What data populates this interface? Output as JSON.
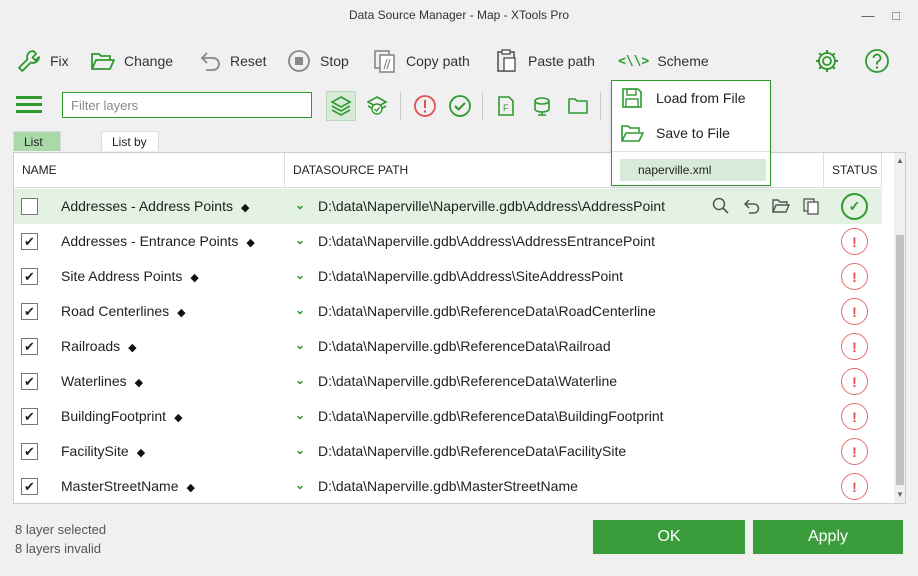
{
  "window": {
    "title": "Data Source Manager - Map  -  XTools Pro",
    "minimize_glyph": "—",
    "maximize_glyph": "□",
    "close_glyph": "✕"
  },
  "toolbar": {
    "fix": "Fix",
    "change": "Change",
    "reset": "Reset",
    "stop": "Stop",
    "copy_path": "Copy path",
    "paste_path": "Paste path",
    "scheme_glyph": "<\\\\>",
    "scheme": "Scheme",
    "settings_icon": "gear-icon",
    "help_icon": "help-icon"
  },
  "filter": {
    "placeholder": "Filter layers"
  },
  "tabs": {
    "by_layer": "List by layer",
    "by_source": "List by source"
  },
  "grid": {
    "headers": {
      "name": "NAME",
      "datasource": "DATASOURCE PATH",
      "status": "STATUS",
      "hidden_fragment": "S"
    },
    "rows": [
      {
        "name": "Addresses - Address Points",
        "checked": false,
        "selected": true,
        "path": "D:\\data\\Naperville\\Naperville.gdb\\Address\\AddressPoint",
        "status": "ok"
      },
      {
        "name": "Addresses - Entrance Points",
        "checked": true,
        "selected": false,
        "path": "D:\\data\\Naperville.gdb\\Address\\AddressEntrancePoint",
        "status": "error"
      },
      {
        "name": "Site Address Points",
        "checked": true,
        "selected": false,
        "path": "D:\\data\\Naperville.gdb\\Address\\SiteAddressPoint",
        "status": "error"
      },
      {
        "name": "Road Centerlines",
        "checked": true,
        "selected": false,
        "path": "D:\\data\\Naperville.gdb\\ReferenceData\\RoadCenterline",
        "status": "error"
      },
      {
        "name": "Railroads",
        "checked": true,
        "selected": false,
        "path": "D:\\data\\Naperville.gdb\\ReferenceData\\Railroad",
        "status": "error"
      },
      {
        "name": "Waterlines",
        "checked": true,
        "selected": false,
        "path": "D:\\data\\Naperville.gdb\\ReferenceData\\Waterline",
        "status": "error"
      },
      {
        "name": "BuildingFootprint",
        "checked": true,
        "selected": false,
        "path": "D:\\data\\Naperville.gdb\\ReferenceData\\BuildingFootprint",
        "status": "error"
      },
      {
        "name": "FacilitySite",
        "checked": true,
        "selected": false,
        "path": "D:\\data\\Naperville.gdb\\ReferenceData\\FacilitySite",
        "status": "error"
      },
      {
        "name": "MasterStreetName",
        "checked": true,
        "selected": false,
        "path": "D:\\data\\Naperville.gdb\\MasterStreetName",
        "status": "error"
      }
    ]
  },
  "dropdown": {
    "load": "Load from File",
    "save": "Save to File",
    "file": "naperville.xml"
  },
  "footer": {
    "selected": "8 layer selected",
    "invalid": "8 layers invalid",
    "ok": "OK",
    "apply": "Apply"
  },
  "colors": {
    "accent": "#2e9a2e",
    "button": "#3a9c3a",
    "error": "#e05050"
  }
}
